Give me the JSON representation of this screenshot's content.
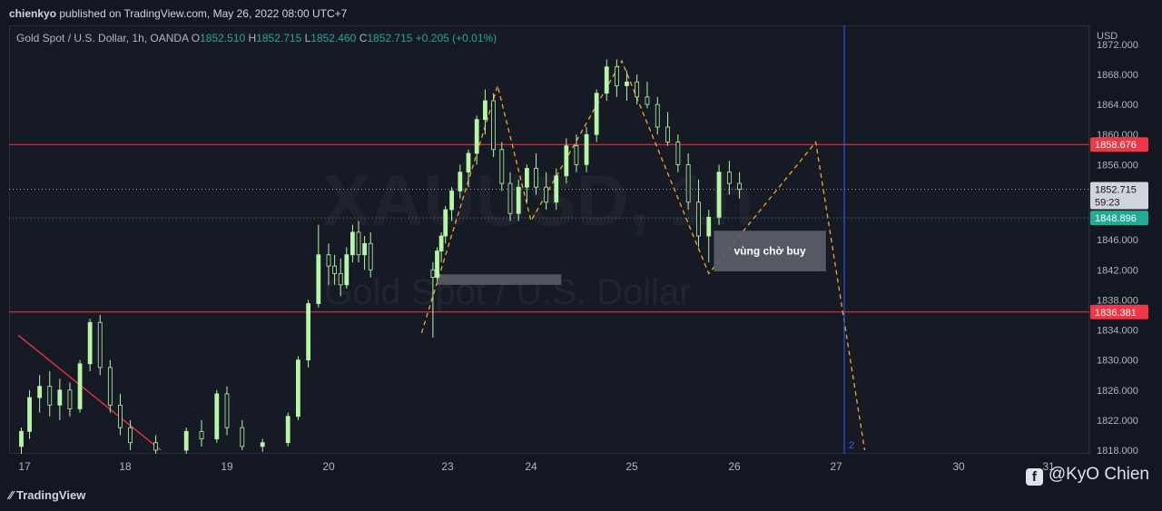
{
  "header": {
    "publisher": "chienkyo",
    "published_text": "published on TradingView.com, May 26, 2022 08:00 UTC+7"
  },
  "legend": {
    "symbol": "Gold Spot / U.S. Dollar, 1h, OANDA",
    "o_label": "O",
    "o": "1852.510",
    "h_label": "H",
    "h": "1852.715",
    "l_label": "L",
    "l": "1852.460",
    "c_label": "C",
    "c": "1852.715",
    "change": "+0.205 (+0.01%)"
  },
  "watermark": {
    "ticker": "XAUUSD, 1h",
    "name": "Gold Spot / U.S. Dollar"
  },
  "currency": "USD",
  "footer": {
    "brand": "TradingView",
    "credit": "@KyO Chien"
  },
  "colors": {
    "up": "#26a69a",
    "candle": "#b7f5a8",
    "resistance": "#f23645",
    "current": "#787b86",
    "cyan": "#22ab94",
    "zigzag": "#f5a623",
    "vline": "#2962ff"
  },
  "chart_data": {
    "type": "candlestick",
    "title": "Gold Spot / U.S. Dollar, 1h, OANDA",
    "x_ticks": [
      {
        "x": 17,
        "label": "17"
      },
      {
        "x": 18,
        "label": "18"
      },
      {
        "x": 19,
        "label": "19"
      },
      {
        "x": 20,
        "label": "20"
      },
      {
        "x": 23,
        "label": "23"
      },
      {
        "x": 24,
        "label": "24"
      },
      {
        "x": 25,
        "label": "25"
      },
      {
        "x": 26,
        "label": "26"
      },
      {
        "x": 27,
        "label": "27"
      },
      {
        "x": 30,
        "label": "30"
      },
      {
        "x": 31,
        "label": "31"
      }
    ],
    "y_ticks": [
      "1872.000",
      "1868.000",
      "1864.000",
      "1860.000",
      "1856.000",
      "1846.000",
      "1842.000",
      "1838.000",
      "1834.000",
      "1830.000",
      "1826.000",
      "1822.000",
      "1818.000"
    ],
    "ylim": [
      1817.5,
      1873.5
    ],
    "price_labels": [
      {
        "value": 1858.676,
        "text": "1858.676",
        "kind": "resistance"
      },
      {
        "value": 1852.715,
        "text": "1852.715",
        "sub": "59:23",
        "kind": "current"
      },
      {
        "value": 1848.896,
        "text": "1848.896",
        "kind": "cyan"
      },
      {
        "value": 1836.381,
        "text": "1836.381",
        "kind": "resistance"
      }
    ],
    "hlines": [
      {
        "value": 1858.676,
        "style": "solid",
        "color": "#f23645"
      },
      {
        "value": 1836.381,
        "style": "solid",
        "color": "#f23645"
      },
      {
        "value": 1852.715,
        "style": "dotted",
        "color": "#9598a1"
      },
      {
        "value": 1848.896,
        "style": "dotted",
        "color": "#22ab94"
      }
    ],
    "vline": {
      "x": 27.2,
      "label": "2"
    },
    "trendline": [
      [
        16.9,
        1833.3
      ],
      [
        18.35,
        1818.0
      ]
    ],
    "zigzag_up1": [
      [
        22.3,
        1833.6
      ],
      [
        23.6,
        1866.5
      ],
      [
        24.0,
        1848.5
      ],
      [
        24.9,
        1869.8
      ],
      [
        25.75,
        1841.5
      ],
      [
        26.8,
        1859.0
      ],
      [
        27.7,
        1818.0
      ]
    ],
    "zone": {
      "x0": 22.75,
      "x1": 24.3,
      "y0": 1841.4,
      "y1": 1840.0
    },
    "annotation": {
      "text": "vùng chờ buy",
      "x0": 25.8,
      "x1": 26.9,
      "y0": 1847.2,
      "y1": 1841.8
    },
    "ohlc": [
      [
        16.95,
        1818.5,
        1821.0,
        1817.5,
        1820.5
      ],
      [
        17.05,
        1820.5,
        1826.0,
        1819.5,
        1825.0
      ],
      [
        17.15,
        1825.0,
        1828.0,
        1823.0,
        1826.5
      ],
      [
        17.25,
        1826.5,
        1828.5,
        1822.5,
        1824.0
      ],
      [
        17.35,
        1824.0,
        1827.5,
        1822.0,
        1826.0
      ],
      [
        17.45,
        1826.0,
        1827.0,
        1822.5,
        1823.5
      ],
      [
        17.55,
        1823.5,
        1830.0,
        1823.0,
        1829.5
      ],
      [
        17.65,
        1829.5,
        1835.5,
        1828.5,
        1835.0
      ],
      [
        17.75,
        1835.0,
        1836.0,
        1828.0,
        1829.0
      ],
      [
        17.85,
        1829.0,
        1830.0,
        1823.0,
        1824.0
      ],
      [
        17.95,
        1824.0,
        1825.5,
        1820.0,
        1821.0
      ],
      [
        18.05,
        1821.0,
        1822.0,
        1818.0,
        1819.0
      ],
      [
        18.3,
        1819.0,
        1820.0,
        1817.5,
        1818.0
      ],
      [
        18.6,
        1818.0,
        1821.0,
        1817.5,
        1820.5
      ],
      [
        18.75,
        1820.5,
        1822.0,
        1818.5,
        1819.5
      ],
      [
        18.9,
        1819.5,
        1826.0,
        1819.0,
        1825.5
      ],
      [
        19.0,
        1825.5,
        1826.5,
        1820.0,
        1821.0
      ],
      [
        19.15,
        1821.0,
        1822.0,
        1818.0,
        1818.5
      ],
      [
        19.35,
        1818.5,
        1819.5,
        1817.8,
        1819.0
      ],
      [
        19.6,
        1819.0,
        1823.0,
        1818.5,
        1822.5
      ],
      [
        19.7,
        1822.5,
        1830.5,
        1822.0,
        1830.0
      ],
      [
        19.8,
        1830.0,
        1838.0,
        1829.0,
        1837.5
      ],
      [
        19.9,
        1837.5,
        1848.0,
        1837.0,
        1844.0
      ],
      [
        20.0,
        1844.0,
        1845.5,
        1840.0,
        1842.5
      ],
      [
        20.1,
        1842.5,
        1844.0,
        1840.0,
        1841.5
      ],
      [
        20.2,
        1841.5,
        1843.5,
        1838.5,
        1840.0
      ],
      [
        20.3,
        1840.0,
        1845.0,
        1839.5,
        1844.0
      ],
      [
        20.4,
        1844.0,
        1848.0,
        1843.0,
        1847.0
      ],
      [
        20.5,
        1847.0,
        1848.5,
        1843.0,
        1844.0
      ],
      [
        20.6,
        1844.0,
        1846.5,
        1842.0,
        1845.5
      ],
      [
        20.7,
        1845.5,
        1847.0,
        1841.0,
        1842.0
      ],
      [
        22.65,
        1842.0,
        1843.0,
        1833.0,
        1841.0
      ],
      [
        22.75,
        1841.0,
        1845.0,
        1840.5,
        1844.5
      ],
      [
        22.85,
        1844.5,
        1847.0,
        1843.0,
        1846.5
      ],
      [
        22.95,
        1846.5,
        1850.5,
        1845.5,
        1850.0
      ],
      [
        23.05,
        1850.0,
        1853.0,
        1848.5,
        1852.5
      ],
      [
        23.15,
        1852.5,
        1856.0,
        1851.5,
        1855.0
      ],
      [
        23.25,
        1855.0,
        1858.0,
        1853.0,
        1857.5
      ],
      [
        23.35,
        1857.5,
        1862.5,
        1856.0,
        1862.0
      ],
      [
        23.45,
        1862.0,
        1866.0,
        1860.0,
        1864.5
      ],
      [
        23.55,
        1864.5,
        1865.5,
        1857.0,
        1858.0
      ],
      [
        23.65,
        1858.0,
        1859.0,
        1852.5,
        1853.5
      ],
      [
        23.75,
        1853.5,
        1855.0,
        1848.5,
        1849.5
      ],
      [
        23.85,
        1849.5,
        1854.0,
        1848.5,
        1853.0
      ],
      [
        23.95,
        1853.0,
        1856.0,
        1851.0,
        1855.5
      ],
      [
        24.05,
        1855.5,
        1857.5,
        1852.0,
        1853.0
      ],
      [
        24.15,
        1853.0,
        1855.0,
        1850.0,
        1851.0
      ],
      [
        24.25,
        1851.0,
        1855.5,
        1850.0,
        1854.5
      ],
      [
        24.35,
        1854.5,
        1859.5,
        1853.5,
        1858.5
      ],
      [
        24.45,
        1858.5,
        1860.0,
        1855.0,
        1856.0
      ],
      [
        24.55,
        1856.0,
        1861.0,
        1855.0,
        1860.0
      ],
      [
        24.65,
        1860.0,
        1866.0,
        1859.0,
        1865.5
      ],
      [
        24.75,
        1865.5,
        1870.0,
        1864.5,
        1869.0
      ],
      [
        24.85,
        1869.0,
        1870.0,
        1865.0,
        1866.5
      ],
      [
        24.95,
        1866.5,
        1868.5,
        1864.5,
        1867.0
      ],
      [
        25.05,
        1867.0,
        1868.0,
        1864.0,
        1865.0
      ],
      [
        25.15,
        1865.0,
        1867.0,
        1863.5,
        1864.0
      ],
      [
        25.25,
        1864.0,
        1865.0,
        1860.0,
        1861.0
      ],
      [
        25.35,
        1861.0,
        1863.0,
        1858.5,
        1859.0
      ],
      [
        25.45,
        1859.0,
        1860.0,
        1855.0,
        1856.0
      ],
      [
        25.55,
        1856.0,
        1857.5,
        1850.0,
        1851.0
      ],
      [
        25.65,
        1851.0,
        1854.0,
        1845.0,
        1846.5
      ],
      [
        25.75,
        1846.5,
        1850.0,
        1843.0,
        1849.0
      ],
      [
        25.85,
        1849.0,
        1856.0,
        1848.0,
        1855.0
      ],
      [
        25.95,
        1855.0,
        1856.5,
        1852.0,
        1853.5
      ],
      [
        26.05,
        1853.5,
        1855.0,
        1851.5,
        1852.7
      ]
    ]
  }
}
